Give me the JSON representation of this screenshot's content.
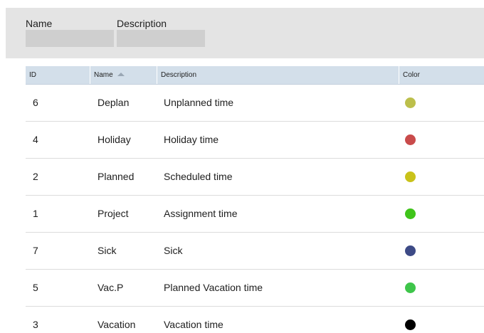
{
  "filters": {
    "name_label": "Name",
    "description_label": "Description",
    "name_value": "",
    "description_value": ""
  },
  "grid": {
    "columns": {
      "id": "ID",
      "name": "Name",
      "description": "Description",
      "color": "Color"
    },
    "sort": {
      "column": "Name",
      "direction": "ascending"
    },
    "rows": [
      {
        "id": "6",
        "name": "Deplan",
        "description": "Unplanned time",
        "color": "#bcbf4b"
      },
      {
        "id": "4",
        "name": "Holiday",
        "description": "Holiday time",
        "color": "#c94b4b"
      },
      {
        "id": "2",
        "name": "Planned",
        "description": "Scheduled time",
        "color": "#c9c21a"
      },
      {
        "id": "1",
        "name": "Project",
        "description": "Assignment time",
        "color": "#3fc41a"
      },
      {
        "id": "7",
        "name": "Sick",
        "description": "Sick",
        "color": "#3d4a86"
      },
      {
        "id": "5",
        "name": "Vac.P",
        "description": "Planned Vacation time",
        "color": "#3ec54a"
      },
      {
        "id": "3",
        "name": "Vacation",
        "description": "Vacation time",
        "color": "#000000"
      }
    ]
  }
}
